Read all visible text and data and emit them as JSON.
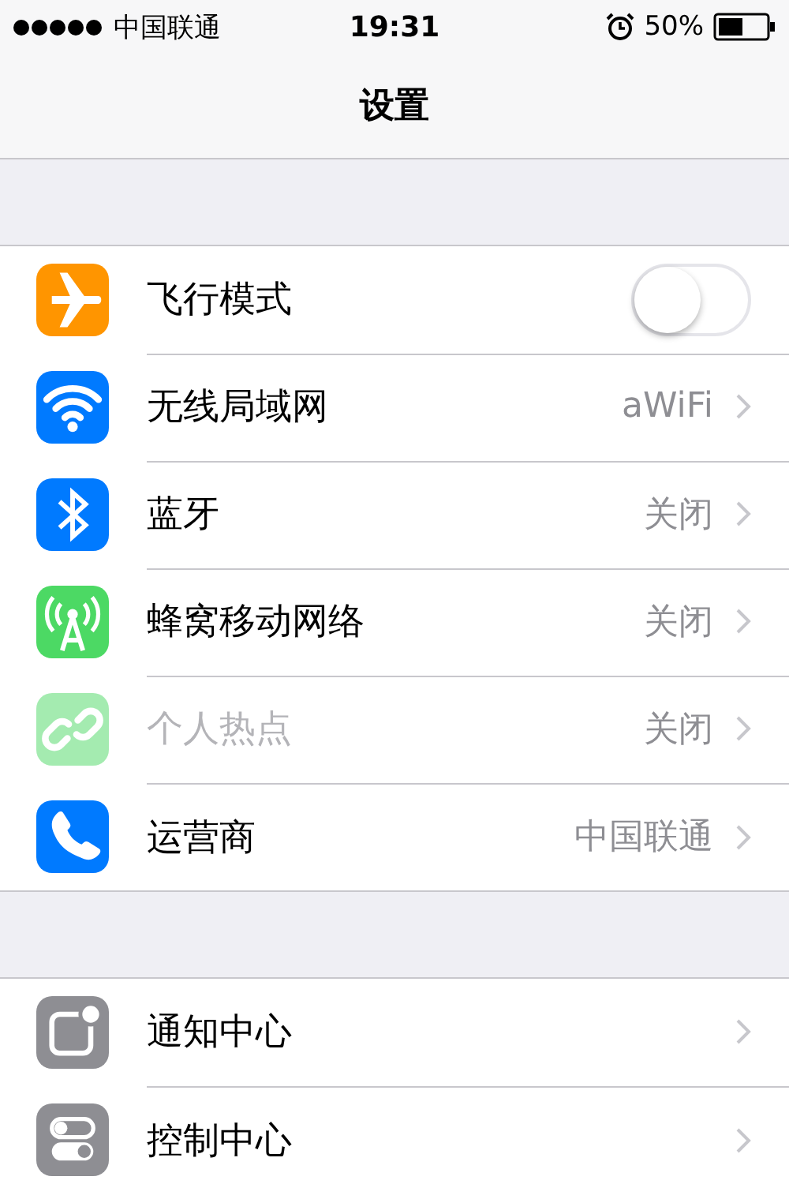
{
  "status_bar": {
    "carrier": "中国联通",
    "time": "19:31",
    "battery": "50%"
  },
  "nav": {
    "title": "设置"
  },
  "groups": [
    {
      "rows": [
        {
          "kind": "toggle",
          "label": "飞行模式",
          "on": false,
          "disabled": false
        },
        {
          "kind": "link",
          "label": "无线局域网",
          "value": "aWiFi",
          "disabled": false
        },
        {
          "kind": "link",
          "label": "蓝牙",
          "value": "关闭",
          "disabled": false
        },
        {
          "kind": "link",
          "label": "蜂窝移动网络",
          "value": "关闭",
          "disabled": false
        },
        {
          "kind": "link",
          "label": "个人热点",
          "value": "关闭",
          "disabled": true
        },
        {
          "kind": "link",
          "label": "运营商",
          "value": "中国联通",
          "disabled": false
        }
      ]
    },
    {
      "rows": [
        {
          "kind": "link",
          "label": "通知中心",
          "disabled": false
        },
        {
          "kind": "link",
          "label": "控制中心",
          "disabled": false
        }
      ]
    }
  ]
}
